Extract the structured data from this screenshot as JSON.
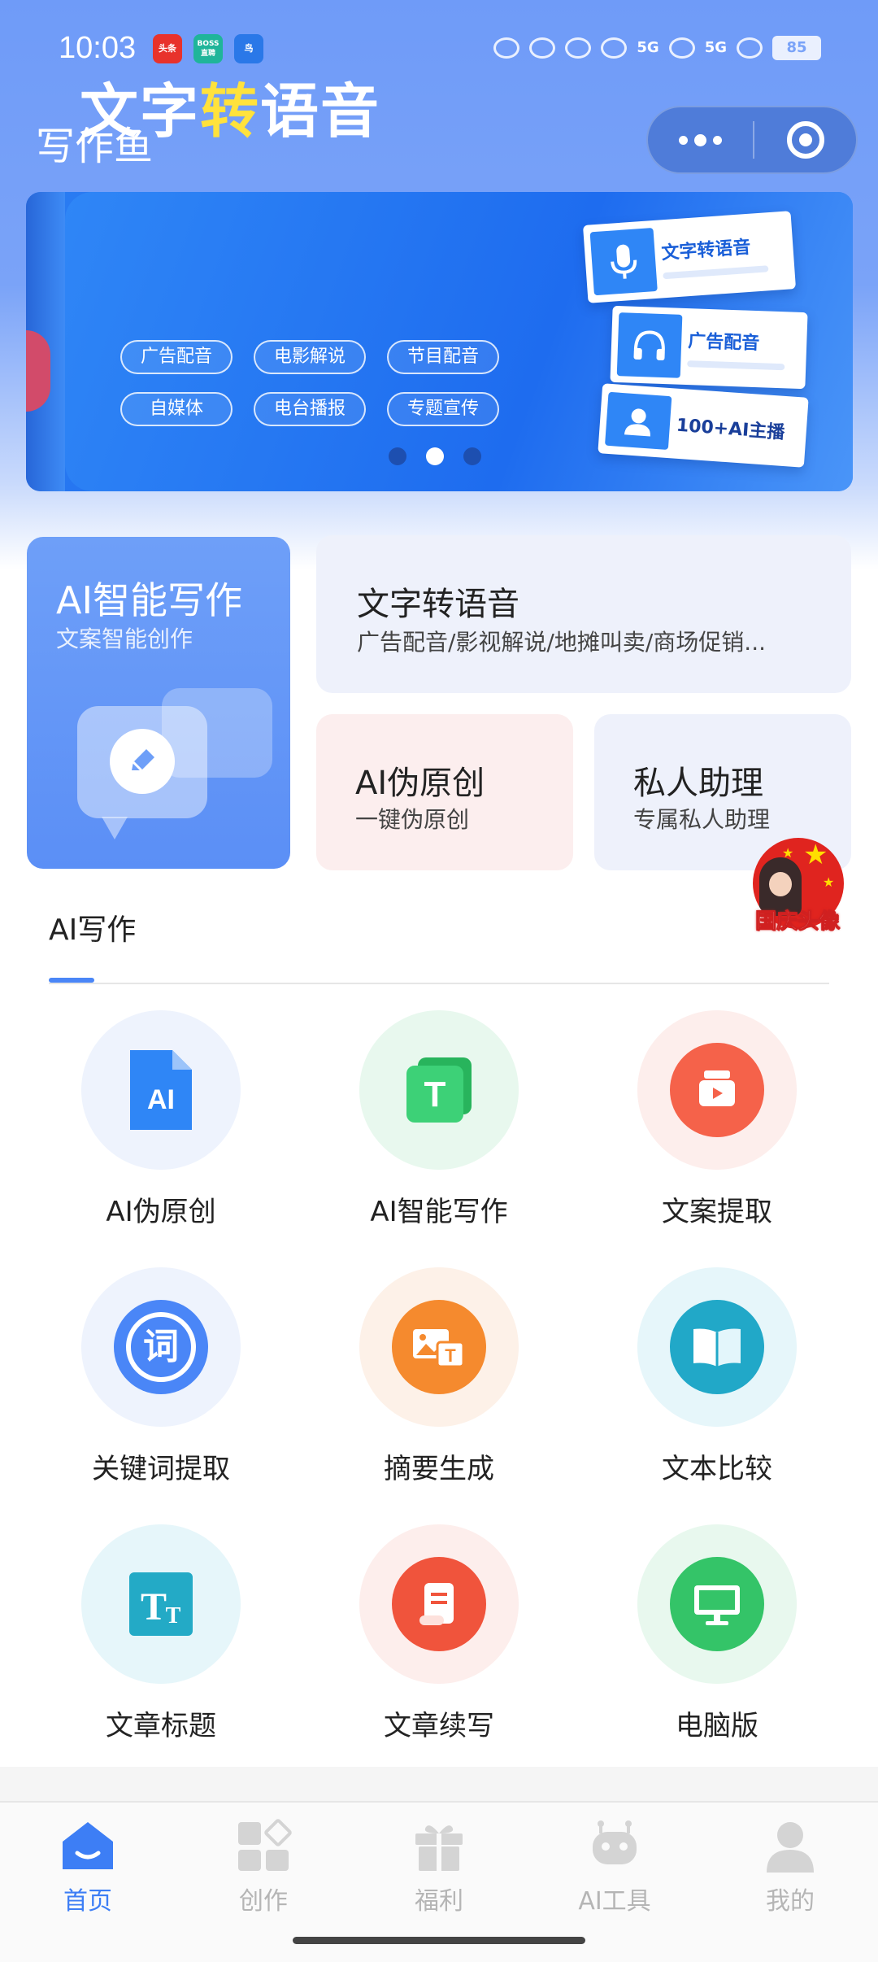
{
  "status_bar": {
    "time": "10:03",
    "app_badges": [
      "头条",
      "BOSS直聘",
      "鸟"
    ],
    "network_labels": [
      "5G",
      "5G"
    ],
    "battery": "85"
  },
  "header": {
    "title": "写作鱼"
  },
  "banner": {
    "title_part1": "文字",
    "title_highlight": "转",
    "title_part2": "语音",
    "tags": [
      "广告配音",
      "电影解说",
      "节目配音",
      "自媒体",
      "电台播报",
      "专题宣传"
    ],
    "cards": [
      "文字转语音",
      "广告配音",
      "100+AI主播"
    ],
    "active_page": 1,
    "page_count": 3
  },
  "features": {
    "ai_writing": {
      "title": "AI智能写作",
      "subtitle": "文案智能创作"
    },
    "tts": {
      "title": "文字转语音",
      "subtitle": "广告配音/影视解说/地摊叫卖/商场促销..."
    },
    "pseudo_original": {
      "title": "AI伪原创",
      "subtitle": "一键伪原创"
    },
    "assistant": {
      "title": "私人助理",
      "subtitle": "专属私人助理"
    }
  },
  "float_badge": {
    "label": "国庆头像"
  },
  "section": {
    "title": "AI写作"
  },
  "tools": [
    {
      "label": "AI伪原创",
      "icon": "ai-document-icon",
      "color": "#2f86f6",
      "bg": "#eef3fd"
    },
    {
      "label": "AI智能写作",
      "icon": "text-t-icon",
      "color": "#2fc86a",
      "bg": "#e8f8ee"
    },
    {
      "label": "文案提取",
      "icon": "video-extract-icon",
      "color": "#f5624a",
      "bg": "#fdeeec"
    },
    {
      "label": "关键词提取",
      "icon": "keyword-icon",
      "color": "#4a86f7",
      "bg": "#eef3fd"
    },
    {
      "label": "摘要生成",
      "icon": "image-text-icon",
      "color": "#f58a2e",
      "bg": "#fdf1e8"
    },
    {
      "label": "文本比较",
      "icon": "open-book-icon",
      "color": "#21a8c8",
      "bg": "#e6f6fa"
    },
    {
      "label": "文章标题",
      "icon": "title-tt-icon",
      "color": "#23aac6",
      "bg": "#e6f6fa"
    },
    {
      "label": "文章续写",
      "icon": "scroll-icon",
      "color": "#f0543c",
      "bg": "#fdeeec"
    },
    {
      "label": "电脑版",
      "icon": "monitor-icon",
      "color": "#34c468",
      "bg": "#e8f8ee"
    }
  ],
  "tabbar": {
    "tabs": [
      {
        "label": "首页",
        "icon": "home-icon",
        "active": true
      },
      {
        "label": "创作",
        "icon": "create-icon",
        "active": false
      },
      {
        "label": "福利",
        "icon": "gift-icon",
        "active": false
      },
      {
        "label": "AI工具",
        "icon": "robot-icon",
        "active": false
      },
      {
        "label": "我的",
        "icon": "profile-icon",
        "active": false
      }
    ]
  },
  "colors": {
    "accent": "#3d7ef5",
    "header_bg": "#6f9bf8"
  }
}
